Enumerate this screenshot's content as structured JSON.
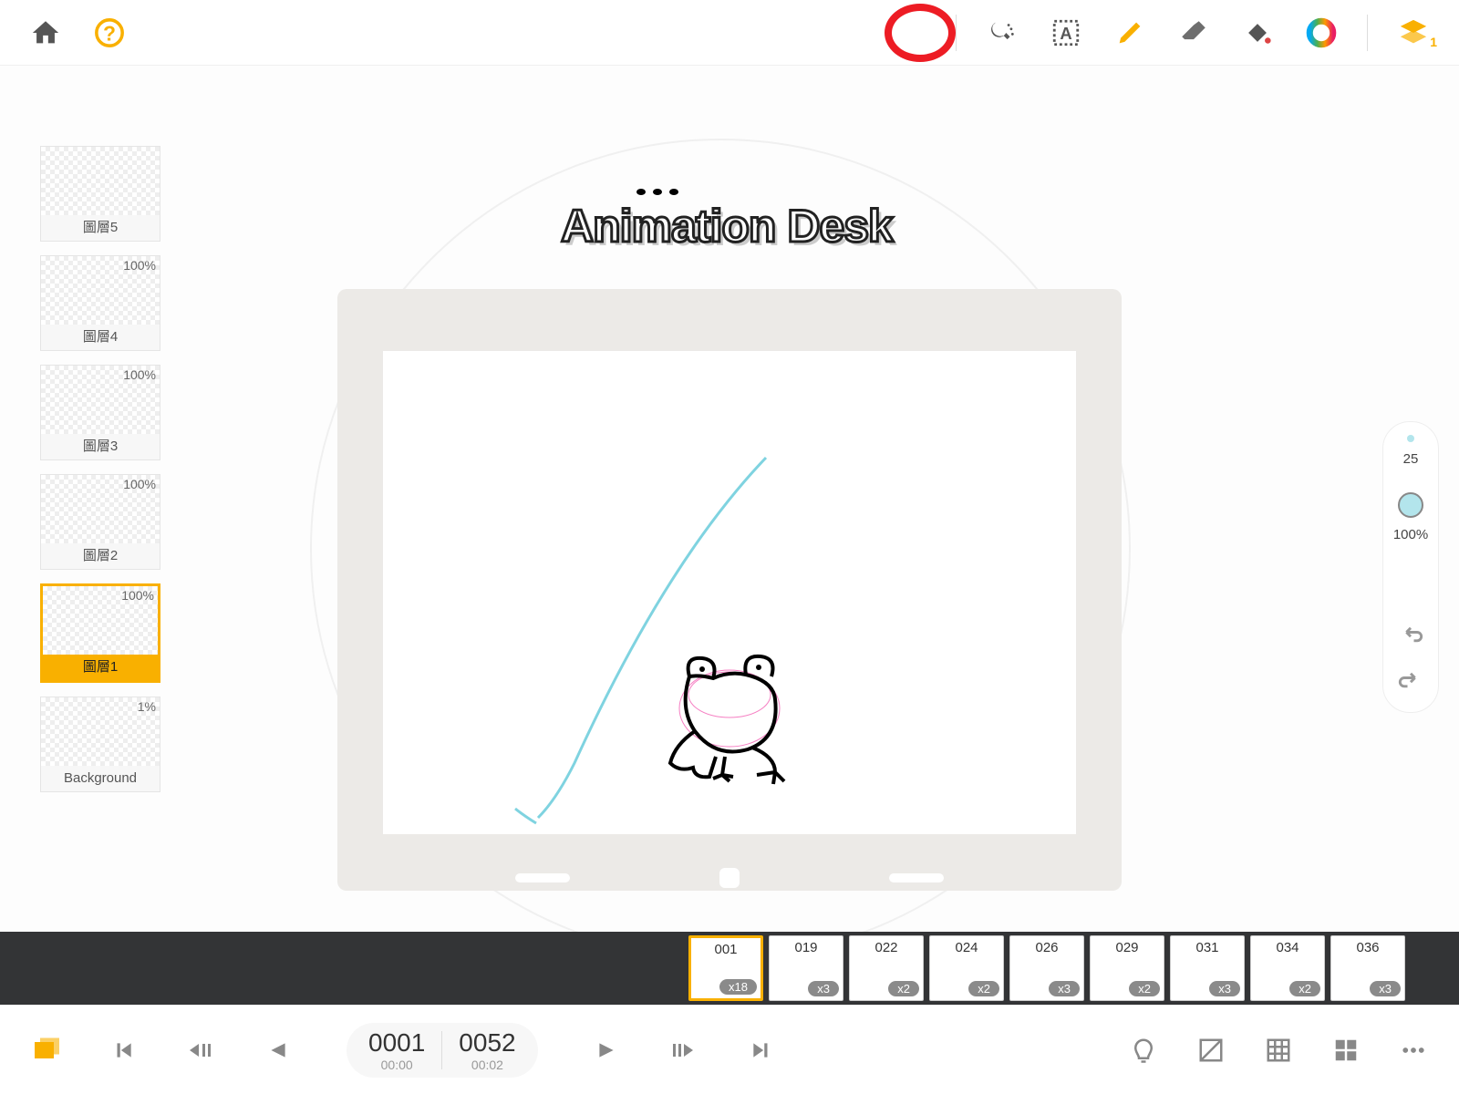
{
  "app": {
    "title": "Animation Desk"
  },
  "toolbar": {
    "layers_badge": "1"
  },
  "layers": [
    {
      "name": "圖層5",
      "opacity": ""
    },
    {
      "name": "圖層4",
      "opacity": "100%"
    },
    {
      "name": "圖層3",
      "opacity": "100%"
    },
    {
      "name": "圖層2",
      "opacity": "100%"
    },
    {
      "name": "圖層1",
      "opacity": "100%",
      "selected": true
    },
    {
      "name": "Background",
      "opacity": "1%"
    }
  ],
  "brush": {
    "size": "25",
    "opacity": "100%"
  },
  "frames": [
    {
      "num": "001",
      "mult": "x18",
      "current": true
    },
    {
      "num": "019",
      "mult": "x3"
    },
    {
      "num": "022",
      "mult": "x2"
    },
    {
      "num": "024",
      "mult": "x2"
    },
    {
      "num": "026",
      "mult": "x3"
    },
    {
      "num": "029",
      "mult": "x2"
    },
    {
      "num": "031",
      "mult": "x3"
    },
    {
      "num": "034",
      "mult": "x2"
    },
    {
      "num": "036",
      "mult": "x3"
    }
  ],
  "playback": {
    "cur_frame": "0001",
    "cur_time": "00:00",
    "total_frame": "0052",
    "total_time": "00:02"
  }
}
